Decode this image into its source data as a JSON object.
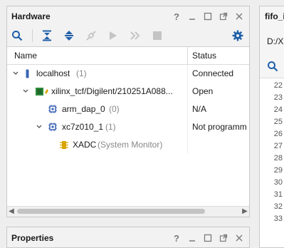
{
  "hardware": {
    "title": "Hardware",
    "controls": {
      "help": "?"
    },
    "columns": {
      "name": "Name",
      "status": "Status"
    },
    "rows": [
      {
        "name": "localhost",
        "count": "(1)",
        "status": "Connected"
      },
      {
        "name": "xilinx_tcf/Digilent/210251A088...",
        "count": "",
        "status": "Open"
      },
      {
        "name": "arm_dap_0",
        "count": "(0)",
        "status": "N/A"
      },
      {
        "name": "xc7z010_1",
        "count": "(1)",
        "status": "Not programm"
      },
      {
        "name": "XADC",
        "count": "(System Monitor)",
        "status": ""
      }
    ]
  },
  "properties": {
    "title": "Properties",
    "controls": {
      "help": "?"
    }
  },
  "right_panel": {
    "title": "fifo_i",
    "path": "D:/Xi",
    "line_numbers": [
      "22",
      "23",
      "24",
      "25",
      "26",
      "27",
      "28",
      "29",
      "30",
      "31",
      "32",
      "33"
    ]
  },
  "colors": {
    "accent": "#1f5fa8",
    "chip_green": "#2e8b3a",
    "chip_gold": "#d9a400"
  }
}
